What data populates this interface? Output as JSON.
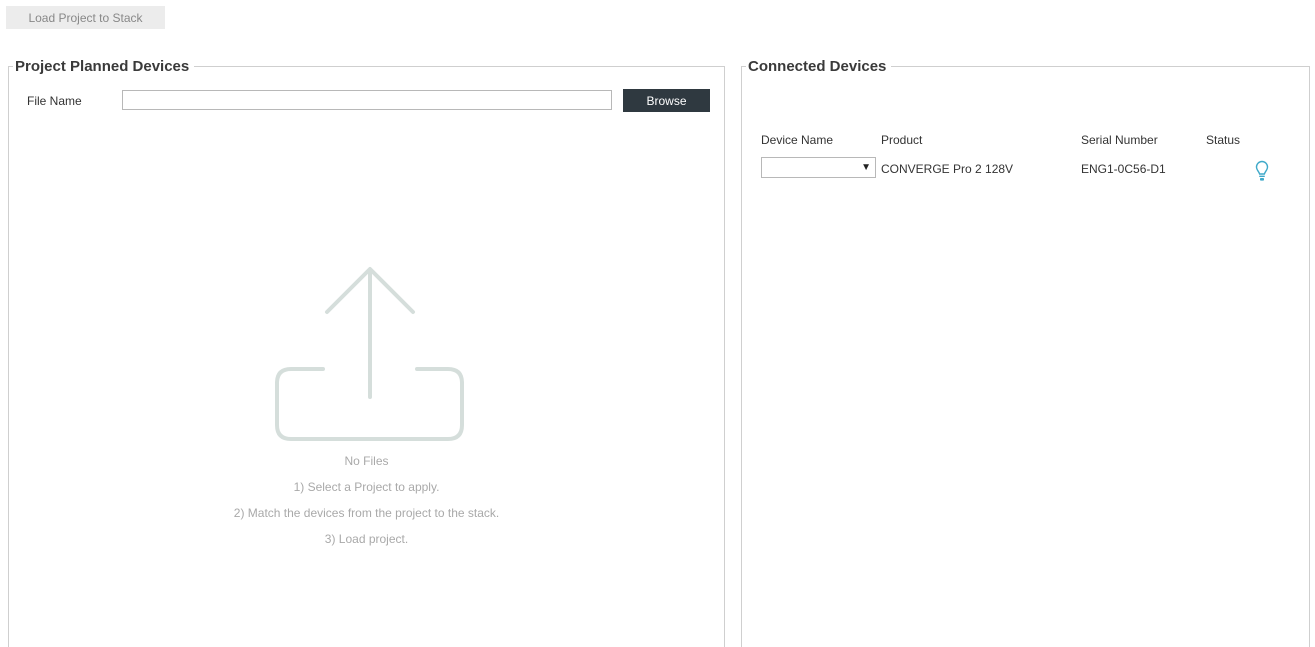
{
  "toolbar": {
    "load_label": "Load Project to Stack"
  },
  "planned": {
    "title": "Project Planned Devices",
    "file_name_label": "File Name",
    "file_name_value": "",
    "browse_label": "Browse",
    "empty_title": "No Files",
    "steps": [
      "1) Select a Project to apply.",
      "2) Match the devices from the project to the stack.",
      "3) Load project."
    ]
  },
  "connected": {
    "title": "Connected Devices",
    "columns": {
      "device_name": "Device Name",
      "product": "Product",
      "serial": "Serial Number",
      "status": "Status"
    },
    "rows": [
      {
        "device_name": "",
        "product": "CONVERGE Pro 2 128V",
        "serial": "ENG1-0C56-D1",
        "status_icon": "lightbulb-icon"
      }
    ]
  },
  "colors": {
    "browse_bg": "#2f3940",
    "status_icon": "#3fa9c9",
    "upload_icon": "#d5dedb"
  }
}
